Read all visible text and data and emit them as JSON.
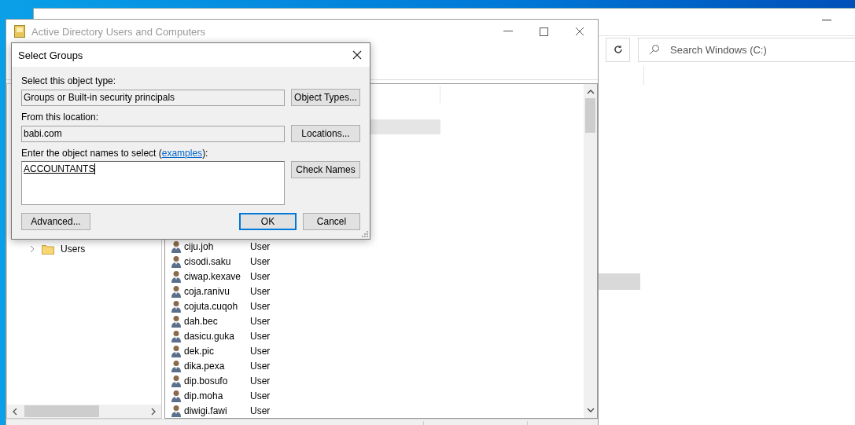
{
  "explorer": {
    "search": {
      "placeholder": "Search Windows (C:)"
    }
  },
  "aduc": {
    "title": "Active Directory Users and Computers",
    "tree": [
      {
        "label": "Users",
        "expanded": false
      }
    ],
    "list": {
      "highlight_row": true,
      "rows": [
        {
          "name": "ciju.joh",
          "type": "User"
        },
        {
          "name": "cisodi.saku",
          "type": "User"
        },
        {
          "name": "ciwap.kexave",
          "type": "User"
        },
        {
          "name": "coja.ranivu",
          "type": "User"
        },
        {
          "name": "cojuta.cuqoh",
          "type": "User"
        },
        {
          "name": "dah.bec",
          "type": "User"
        },
        {
          "name": "dasicu.guka",
          "type": "User"
        },
        {
          "name": "dek.pic",
          "type": "User"
        },
        {
          "name": "dika.pexa",
          "type": "User"
        },
        {
          "name": "dip.bosufo",
          "type": "User"
        },
        {
          "name": "dip.moha",
          "type": "User"
        },
        {
          "name": "diwigi.fawi",
          "type": "User"
        }
      ]
    }
  },
  "dialog": {
    "title": "Select Groups",
    "object_type": {
      "label": "Select this object type:",
      "value": "Groups or Built-in security principals",
      "button": "Object Types..."
    },
    "location": {
      "label": "From this location:",
      "value": "babi.com",
      "button": "Locations..."
    },
    "names": {
      "label_before": "Enter the object names to select (",
      "link": "examples",
      "label_after": "):",
      "value": "ACCOUNTANTS",
      "button": "Check Names"
    },
    "buttons": [
      {
        "label": "Advanced...",
        "kind": "left",
        "default": false
      },
      {
        "label": "OK",
        "kind": "right",
        "default": true
      },
      {
        "label": "Cancel",
        "kind": "right",
        "default": false
      }
    ]
  }
}
